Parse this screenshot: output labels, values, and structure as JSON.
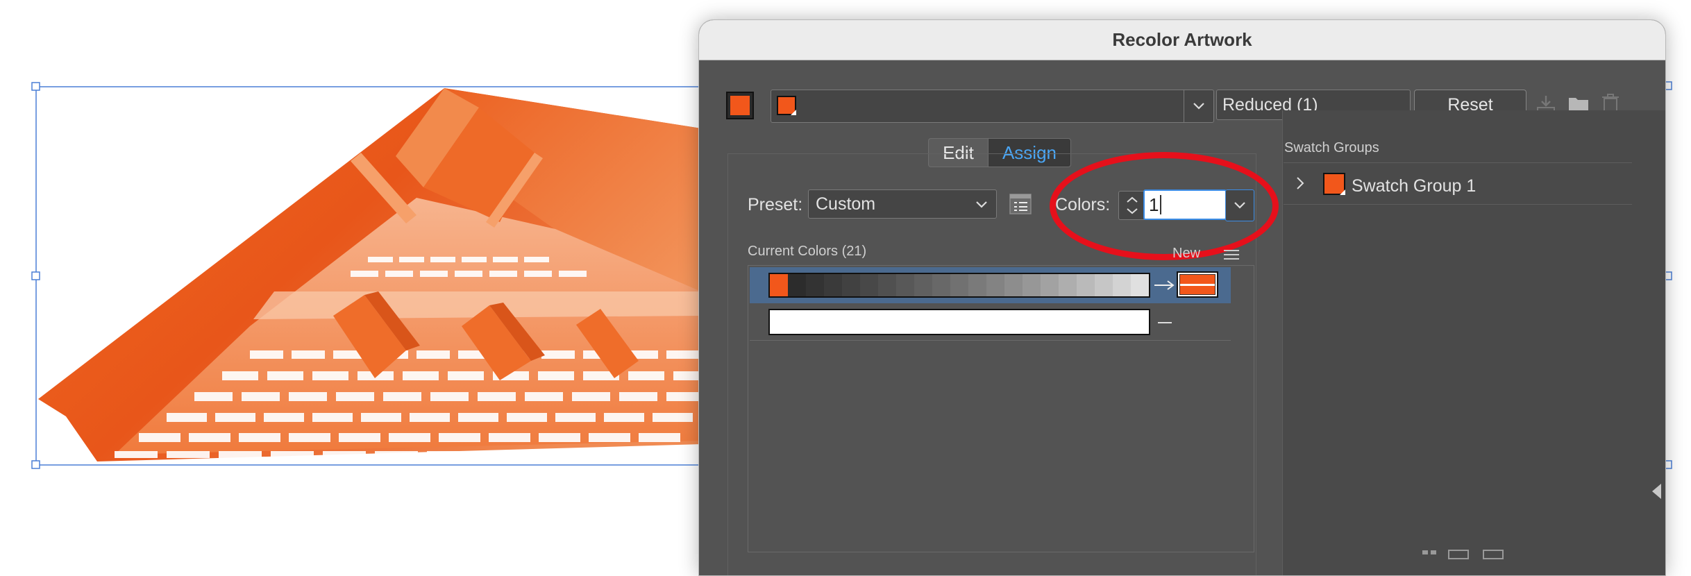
{
  "dialog": {
    "title": "Recolor Artwork",
    "colors_reduced": "Reduced (1)",
    "reset_label": "Reset",
    "tabs": {
      "edit": "Edit",
      "assign": "Assign"
    },
    "preset_label": "Preset:",
    "preset_value": "Custom",
    "colors_label": "Colors:",
    "colors_value": "1",
    "current_colors_label": "Current Colors (21)",
    "new_label": "New",
    "swatch_groups_label": "Swatch Groups",
    "swatch_group_name": "Swatch Group 1"
  },
  "colors": {
    "accent": "#f2571b",
    "highlight": "#e6101b",
    "selection": "#3b8ce6"
  }
}
